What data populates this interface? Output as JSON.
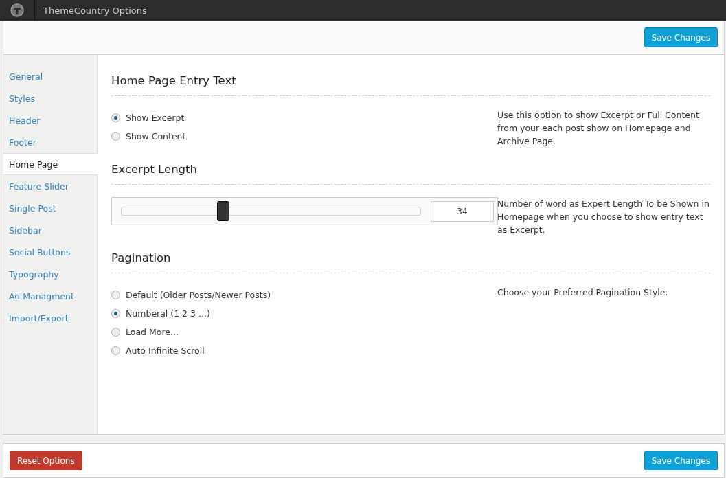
{
  "top_bar": {
    "title": "ThemeCountry Options"
  },
  "header": {
    "save_button": "Save Changes"
  },
  "sidebar": {
    "items": [
      {
        "label": "General",
        "selected": false
      },
      {
        "label": "Styles",
        "selected": false
      },
      {
        "label": "Header",
        "selected": false
      },
      {
        "label": "Footer",
        "selected": false
      },
      {
        "label": "Home Page",
        "selected": true
      },
      {
        "label": "Feature Slider",
        "selected": false
      },
      {
        "label": "Single Post",
        "selected": false
      },
      {
        "label": "Sidebar",
        "selected": false
      },
      {
        "label": "Social Buttons",
        "selected": false
      },
      {
        "label": "Typography",
        "selected": false
      },
      {
        "label": "Ad Managment",
        "selected": false
      },
      {
        "label": "Import/Export",
        "selected": false
      }
    ]
  },
  "sections": [
    {
      "kind": "radio",
      "title": "Home Page Entry Text",
      "description": "Use this option to show Excerpt or Full Content from your each post show on Homepage and Archive Page.",
      "options": [
        {
          "label": "Show Excerpt",
          "selected": true
        },
        {
          "label": "Show Content",
          "selected": false
        }
      ]
    },
    {
      "kind": "slider",
      "title": "Excerpt Length",
      "description": "Number of word as Expert Length To be Shown in Homepage when you choose to show entry text as Excerpt.",
      "slider": {
        "level": 0.34,
        "value": "34"
      }
    },
    {
      "kind": "radio",
      "title": "Pagination",
      "description": "Choose your Preferred Pagination Style.",
      "options": [
        {
          "label": "Default (Older Posts/Newer Posts)",
          "selected": false
        },
        {
          "label": "Numberal (1 2 3 ...)",
          "selected": true
        },
        {
          "label": "Load More...",
          "selected": false
        },
        {
          "label": "Auto Infinite Scroll",
          "selected": false
        }
      ]
    }
  ],
  "footer": {
    "reset_button": "Reset Options",
    "save_button": "Save Changes"
  }
}
